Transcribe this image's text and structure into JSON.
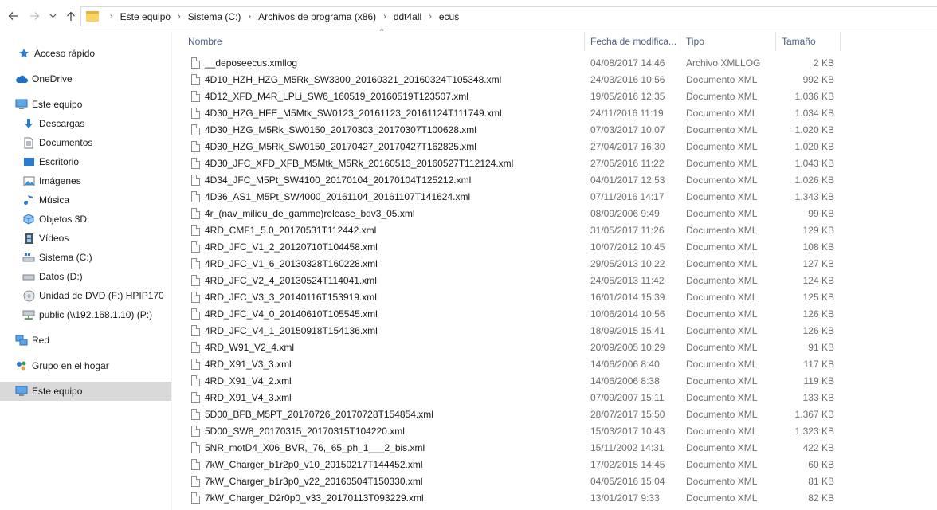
{
  "nav": {
    "back_icon": "arrow-left-icon",
    "forward_icon": "arrow-right-icon",
    "recent_icon": "chevron-down-icon",
    "up_icon": "arrow-up-icon"
  },
  "breadcrumb": [
    "Este equipo",
    "Sistema (C:)",
    "Archivos de programa (x86)",
    "ddt4all",
    "ecus"
  ],
  "sidebar": {
    "items": [
      {
        "label": "Acceso rápido",
        "icon": "star-icon"
      },
      {
        "label": "OneDrive",
        "icon": "cloud-icon"
      },
      {
        "label": "Este equipo",
        "icon": "computer-icon"
      },
      {
        "label": "Descargas",
        "icon": "download-icon"
      },
      {
        "label": "Documentos",
        "icon": "document-icon"
      },
      {
        "label": "Escritorio",
        "icon": "desktop-icon"
      },
      {
        "label": "Imágenes",
        "icon": "pictures-icon"
      },
      {
        "label": "Música",
        "icon": "music-icon"
      },
      {
        "label": "Objetos 3D",
        "icon": "cube-icon"
      },
      {
        "label": "Vídeos",
        "icon": "film-icon"
      },
      {
        "label": "Sistema (C:)",
        "icon": "windows-drive-icon"
      },
      {
        "label": "Datos (D:)",
        "icon": "drive-icon"
      },
      {
        "label": "Unidad de DVD (F:) HPIP170",
        "icon": "dvd-icon"
      },
      {
        "label": "public (\\\\192.168.1.10) (P:)",
        "icon": "network-drive-icon"
      },
      {
        "label": "Red",
        "icon": "network-icon"
      },
      {
        "label": "Grupo en el hogar",
        "icon": "homegroup-icon"
      },
      {
        "label": "Este equipo",
        "icon": "computer-icon"
      }
    ]
  },
  "columns": {
    "name": "Nombre",
    "date": "Fecha de modifica...",
    "type": "Tipo",
    "size": "Tamaño"
  },
  "files": [
    {
      "name": "__deposeecus.xmllog",
      "date": "04/08/2017 14:46",
      "type": "Archivo XMLLOG",
      "size": "2 KB"
    },
    {
      "name": "4D10_HZH_HZG_M5Rk_SW3300_20160321_20160324T105348.xml",
      "date": "24/03/2016 10:56",
      "type": "Documento XML",
      "size": "992 KB"
    },
    {
      "name": "4D12_XFD_M4R_LPLi_SW6_160519_20160519T123507.xml",
      "date": "19/05/2016 12:35",
      "type": "Documento XML",
      "size": "1.036 KB"
    },
    {
      "name": "4D30_HZG_HFE_M5Mtk_SW0123_20161123_20161124T111749.xml",
      "date": "24/11/2016 11:19",
      "type": "Documento XML",
      "size": "1.034 KB"
    },
    {
      "name": "4D30_HZG_M5Rk_SW0150_20170303_20170307T100628.xml",
      "date": "07/03/2017 10:07",
      "type": "Documento XML",
      "size": "1.020 KB"
    },
    {
      "name": "4D30_HZG_M5Rk_SW0150_20170427_20170427T162825.xml",
      "date": "27/04/2017 16:30",
      "type": "Documento XML",
      "size": "1.020 KB"
    },
    {
      "name": "4D30_JFC_XFD_XFB_M5Mtk_M5Rk_20160513_20160527T112124.xml",
      "date": "27/05/2016 11:22",
      "type": "Documento XML",
      "size": "1.043 KB"
    },
    {
      "name": "4D34_JFC_M5Pt_SW4100_20170104_20170104T125212.xml",
      "date": "04/01/2017 12:53",
      "type": "Documento XML",
      "size": "1.026 KB"
    },
    {
      "name": "4D36_AS1_M5Pt_SW4000_20161104_20161107T141624.xml",
      "date": "07/11/2016 14:17",
      "type": "Documento XML",
      "size": "1.343 KB"
    },
    {
      "name": "4r_(nav_milieu_de_gamme)release_bdv3_05.xml",
      "date": "08/09/2006 9:49",
      "type": "Documento XML",
      "size": "99 KB"
    },
    {
      "name": "4RD_CMF1_5.0_20170531T112442.xml",
      "date": "31/05/2017 11:26",
      "type": "Documento XML",
      "size": "129 KB"
    },
    {
      "name": "4RD_JFC_V1_2_20120710T104458.xml",
      "date": "10/07/2012 10:45",
      "type": "Documento XML",
      "size": "108 KB"
    },
    {
      "name": "4RD_JFC_V1_6_20130328T160228.xml",
      "date": "29/05/2013 10:22",
      "type": "Documento XML",
      "size": "127 KB"
    },
    {
      "name": "4RD_JFC_V2_4_20130524T114041.xml",
      "date": "24/05/2013 11:42",
      "type": "Documento XML",
      "size": "124 KB"
    },
    {
      "name": "4RD_JFC_V3_3_20140116T153919.xml",
      "date": "16/01/2014 15:39",
      "type": "Documento XML",
      "size": "125 KB"
    },
    {
      "name": "4RD_JFC_V4_0_20140610T105545.xml",
      "date": "10/06/2014 10:56",
      "type": "Documento XML",
      "size": "126 KB"
    },
    {
      "name": "4RD_JFC_V4_1_20150918T154136.xml",
      "date": "18/09/2015 15:41",
      "type": "Documento XML",
      "size": "126 KB"
    },
    {
      "name": "4RD_W91_V2_4.xml",
      "date": "20/09/2005 10:29",
      "type": "Documento XML",
      "size": "91 KB"
    },
    {
      "name": "4RD_X91_V3_3.xml",
      "date": "14/06/2006 8:40",
      "type": "Documento XML",
      "size": "117 KB"
    },
    {
      "name": "4RD_X91_V4_2.xml",
      "date": "14/06/2006 8:38",
      "type": "Documento XML",
      "size": "119 KB"
    },
    {
      "name": "4RD_X91_V4_3.xml",
      "date": "07/09/2007 15:11",
      "type": "Documento XML",
      "size": "133 KB"
    },
    {
      "name": "5D00_BFB_M5PT_20170726_20170728T154854.xml",
      "date": "28/07/2017 15:50",
      "type": "Documento XML",
      "size": "1.367 KB"
    },
    {
      "name": "5D00_SW8_20170315_20170315T104220.xml",
      "date": "15/03/2017 10:43",
      "type": "Documento XML",
      "size": "1.323 KB"
    },
    {
      "name": "5NR_motD4_X06_BVR,_76,_65_ph_1___2_bis.xml",
      "date": "15/11/2002 14:31",
      "type": "Documento XML",
      "size": "422 KB"
    },
    {
      "name": "7kW_Charger_b1r2p0_v10_20150217T144452.xml",
      "date": "17/02/2015 14:45",
      "type": "Documento XML",
      "size": "60 KB"
    },
    {
      "name": "7kW_Charger_b1r3p0_v22_20160504T150330.xml",
      "date": "04/05/2016 15:04",
      "type": "Documento XML",
      "size": "81 KB"
    },
    {
      "name": "7kW_Charger_D2r0p0_v33_20170113T093229.xml",
      "date": "13/01/2017 9:33",
      "type": "Documento XML",
      "size": "82 KB"
    }
  ]
}
